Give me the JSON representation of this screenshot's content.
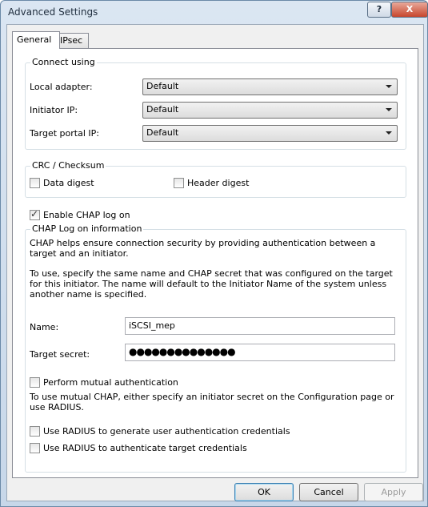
{
  "window": {
    "title": "Advanced Settings",
    "help_glyph": "?",
    "close_glyph": "X"
  },
  "tabs": [
    {
      "label": "General"
    },
    {
      "label": "IPsec"
    }
  ],
  "connect_using": {
    "legend": "Connect using",
    "fields": [
      {
        "label": "Local adapter:",
        "value": "Default"
      },
      {
        "label": "Initiator IP:",
        "value": "Default"
      },
      {
        "label": "Target portal IP:",
        "value": "Default"
      }
    ]
  },
  "crc": {
    "legend": "CRC / Checksum",
    "data_digest": {
      "label": "Data digest",
      "checked": false
    },
    "header_digest": {
      "label": "Header digest",
      "checked": false
    }
  },
  "chap": {
    "enable": {
      "label": "Enable CHAP log on",
      "checked": true
    },
    "legend": "CHAP Log on information",
    "desc1": "CHAP helps ensure connection security by providing authentication between a target and an initiator.",
    "desc2": "To use, specify the same name and CHAP secret that was configured on the target for this initiator.  The name will default to the Initiator Name of the system unless another name is specified.",
    "name_label": "Name:",
    "name_value": "iSCSI_mep",
    "secret_label": "Target secret:",
    "secret_value": "●●●●●●●●●●●●●●",
    "mutual": {
      "label": "Perform mutual authentication",
      "checked": false
    },
    "mutual_desc": "To use mutual CHAP, either specify an initiator secret on the Configuration page or use RADIUS.",
    "radius_user": {
      "label": "Use RADIUS to generate user authentication credentials",
      "checked": false
    },
    "radius_target": {
      "label": "Use RADIUS to authenticate target credentials",
      "checked": false
    }
  },
  "buttons": {
    "ok": "OK",
    "cancel": "Cancel",
    "apply": "Apply"
  }
}
